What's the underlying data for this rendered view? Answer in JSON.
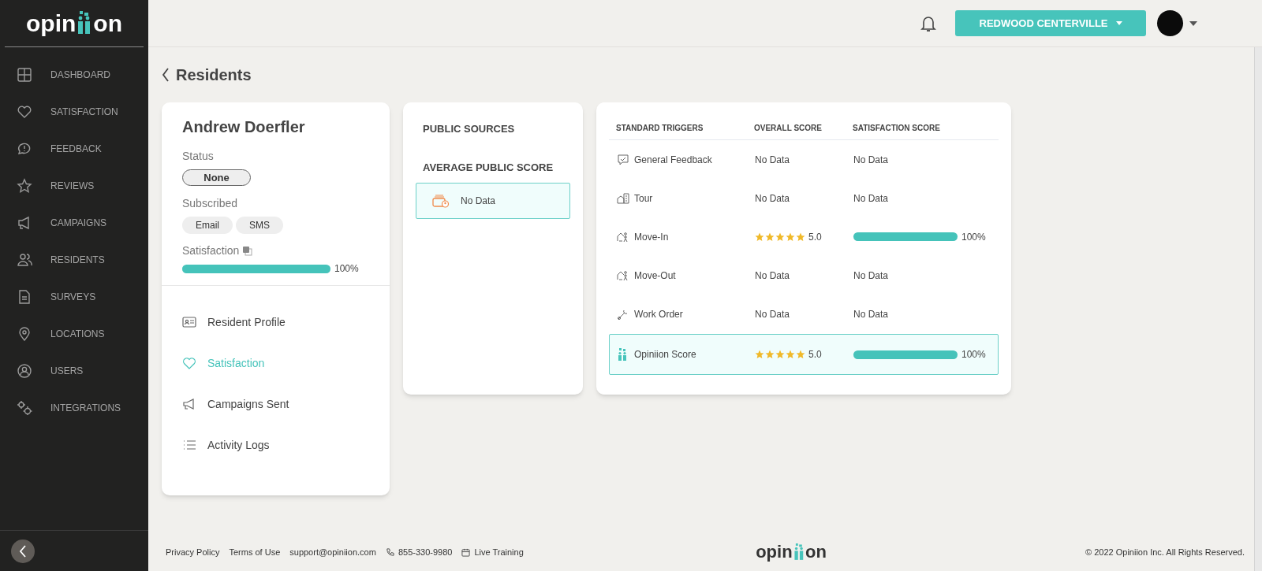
{
  "logo": {
    "before": "opin",
    "after": "on"
  },
  "sidebar": {
    "items": [
      {
        "label": "DASHBOARD",
        "selected": false
      },
      {
        "label": "SATISFACTION",
        "selected": false
      },
      {
        "label": "FEEDBACK",
        "selected": false
      },
      {
        "label": "REVIEWS",
        "selected": false
      },
      {
        "label": "CAMPAIGNS",
        "selected": false
      },
      {
        "label": "RESIDENTS",
        "selected": false
      },
      {
        "label": "SURVEYS",
        "selected": false
      },
      {
        "label": "LOCATIONS",
        "selected": false
      },
      {
        "label": "USERS",
        "selected": false
      },
      {
        "label": "INTEGRATIONS",
        "selected": false
      }
    ]
  },
  "header": {
    "location": "REDWOOD CENTERVILLE"
  },
  "page_title": "Residents",
  "profile": {
    "name": "Andrew Doerfler",
    "status_label": "Status",
    "status": "None",
    "subscribed_label": "Subscribed",
    "channels": [
      "Email",
      "SMS"
    ],
    "satisfaction_label": "Satisfaction",
    "satisfaction": {
      "level": 1,
      "reading": "100%"
    },
    "nav": [
      {
        "label": "Resident Profile",
        "selected": false
      },
      {
        "label": "Satisfaction",
        "selected": true
      },
      {
        "label": "Campaigns Sent",
        "selected": false
      },
      {
        "label": "Activity Logs",
        "selected": false
      }
    ]
  },
  "public": {
    "title": "PUBLIC SOURCES",
    "average_title": "AVERAGE PUBLIC SCORE",
    "average_value": "No Data"
  },
  "triggers": {
    "columns": [
      "STANDARD TRIGGERS",
      "OVERALL SCORE",
      "SATISFACTION SCORE"
    ],
    "rows": [
      {
        "name": "General Feedback",
        "highlighted": false,
        "overall": {
          "kind": "text",
          "text": "No Data"
        },
        "satisfaction": {
          "kind": "text",
          "text": "No Data"
        }
      },
      {
        "name": "Tour",
        "highlighted": false,
        "overall": {
          "kind": "text",
          "text": "No Data"
        },
        "satisfaction": {
          "kind": "text",
          "text": "No Data"
        }
      },
      {
        "name": "Move-In",
        "highlighted": false,
        "overall": {
          "kind": "stars",
          "stars": 5,
          "reading": "5.0"
        },
        "satisfaction": {
          "kind": "bar",
          "level": 1,
          "reading": "100%"
        }
      },
      {
        "name": "Move-Out",
        "highlighted": false,
        "overall": {
          "kind": "text",
          "text": "No Data"
        },
        "satisfaction": {
          "kind": "text",
          "text": "No Data"
        }
      },
      {
        "name": "Work Order",
        "highlighted": false,
        "overall": {
          "kind": "text",
          "text": "No Data"
        },
        "satisfaction": {
          "kind": "text",
          "text": "No Data"
        }
      },
      {
        "name": "Opiniion Score",
        "highlighted": true,
        "overall": {
          "kind": "stars",
          "stars": 5,
          "reading": "5.0"
        },
        "satisfaction": {
          "kind": "bar",
          "level": 1,
          "reading": "100%"
        }
      }
    ]
  },
  "footer": {
    "links": [
      "Privacy Policy",
      "Terms of Use",
      "support@opiniion.com"
    ],
    "phone": "855-330-9980",
    "training": "Live Training",
    "logo": {
      "before": "opin",
      "after": "on"
    },
    "copyright": "© 2022 Opiniion Inc. All Rights Reserved."
  }
}
